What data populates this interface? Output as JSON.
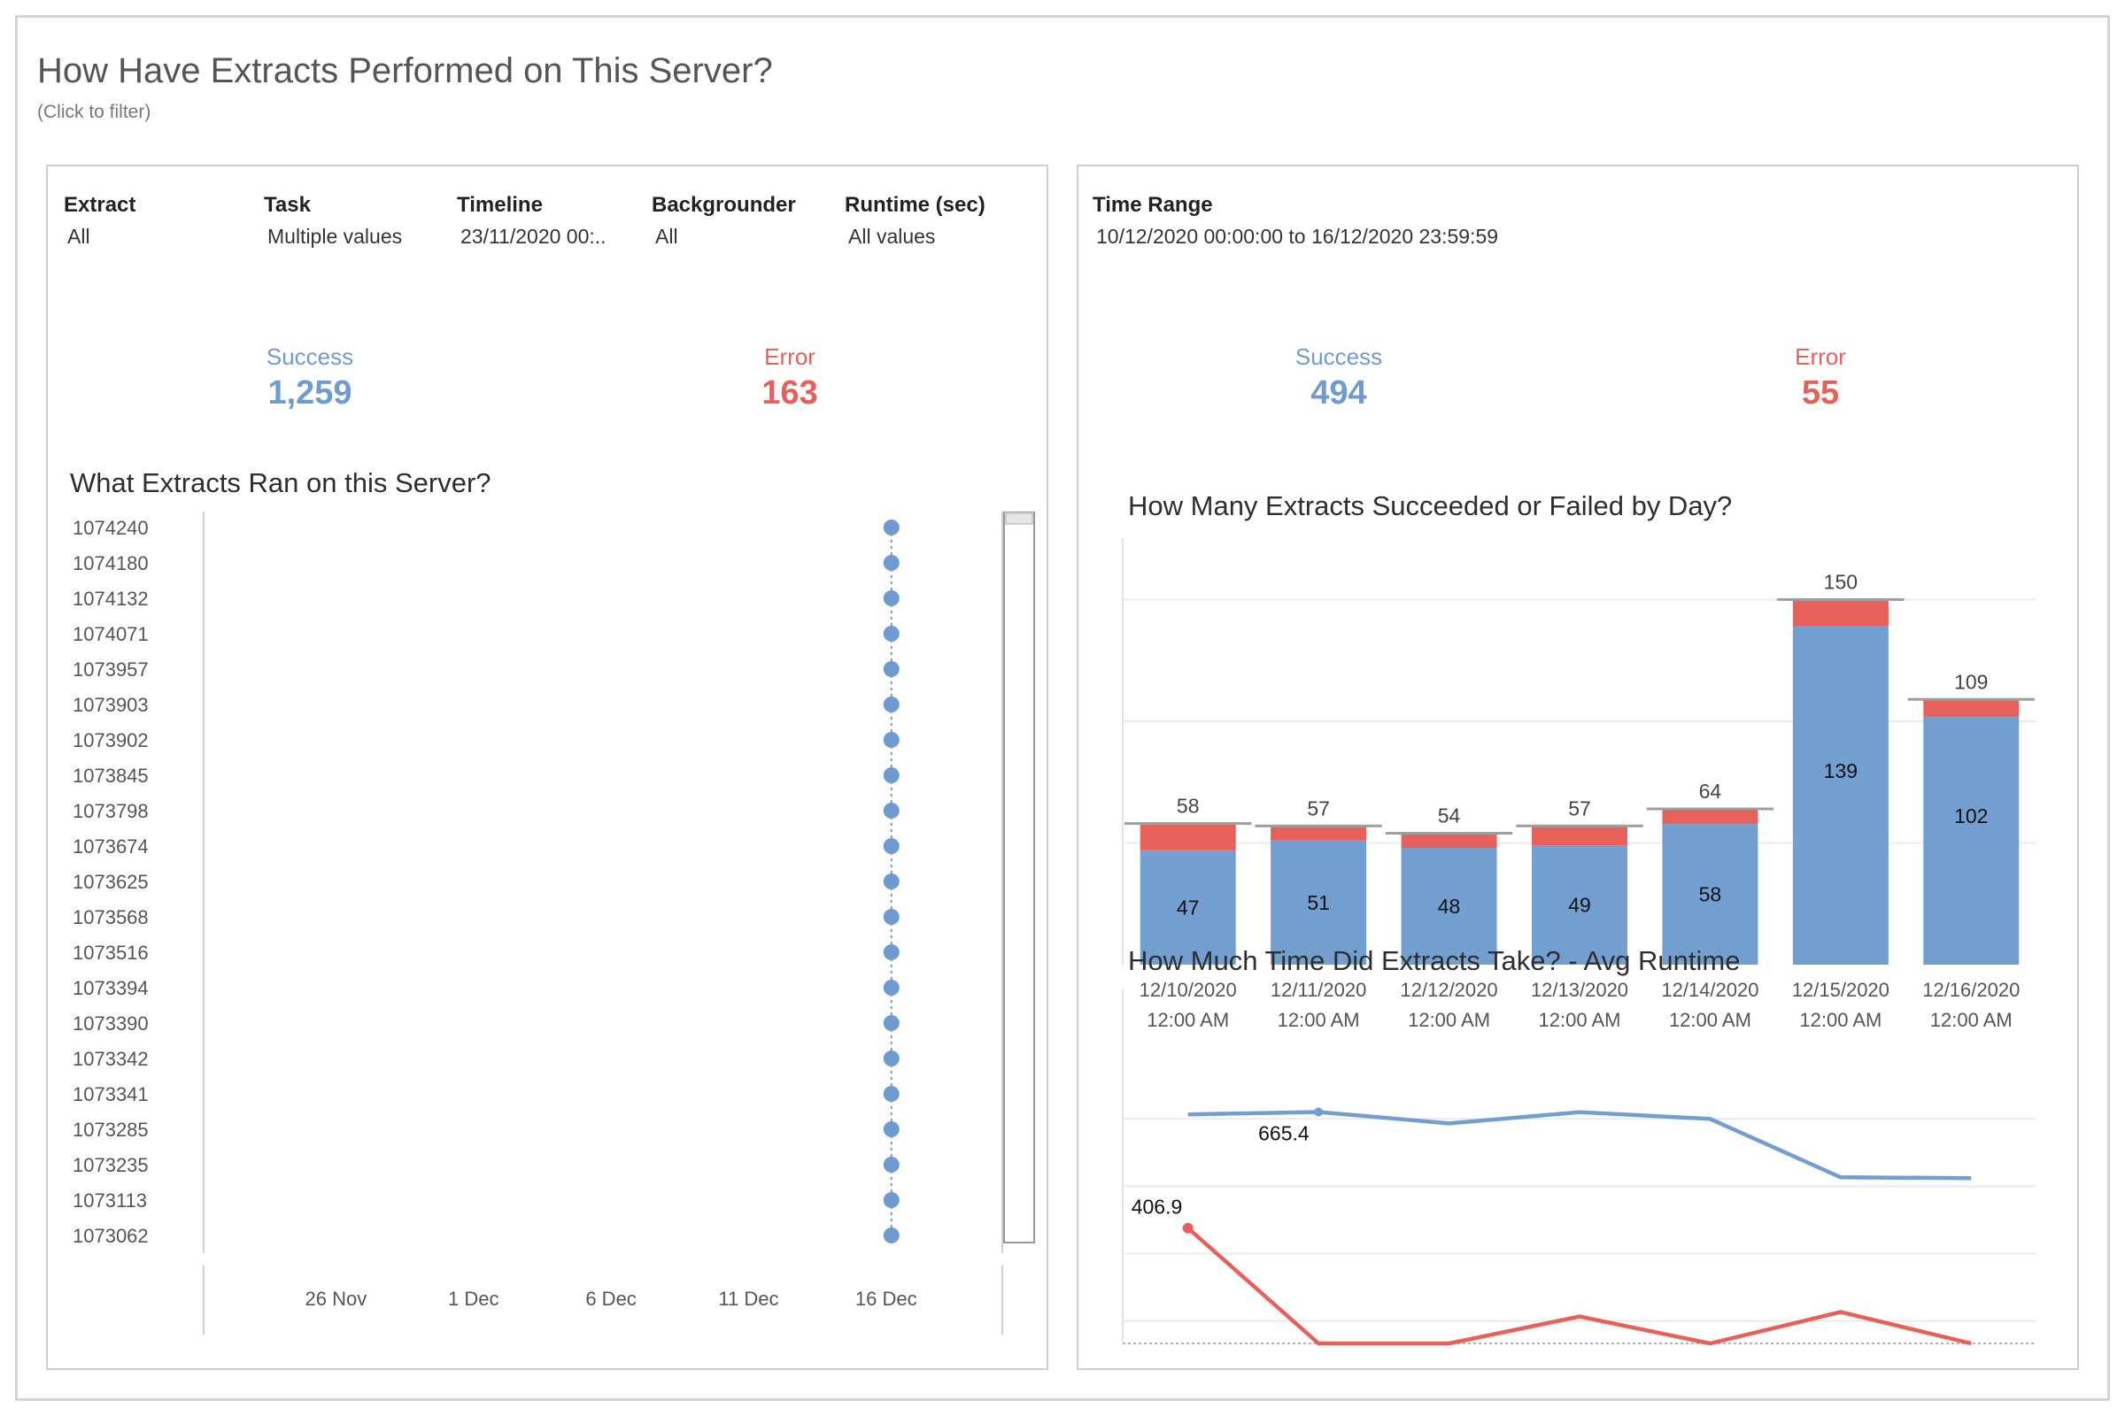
{
  "header": {
    "title": "How Have Extracts Performed on This Server?",
    "subtitle": "(Click to filter)"
  },
  "left_panel": {
    "filters": [
      {
        "label": "Extract",
        "value": "All"
      },
      {
        "label": "Task",
        "value": "Multiple values"
      },
      {
        "label": "Timeline",
        "value": "23/11/2020 00:.."
      },
      {
        "label": "Backgrounder",
        "value": "All"
      },
      {
        "label": "Runtime (sec)",
        "value": "All values"
      }
    ],
    "kpis": {
      "success_label": "Success",
      "success_value": "1,259",
      "error_label": "Error",
      "error_value": "163"
    },
    "chart_title": "What Extracts Ran on this Server?"
  },
  "right_panel": {
    "filters": [
      {
        "label": "Time Range",
        "value": "10/12/2020 00:00:00 to 16/12/2020 23:59:59"
      }
    ],
    "kpis": {
      "success_label": "Success",
      "success_value": "494",
      "error_label": "Error",
      "error_value": "55"
    },
    "bar_title": "How Many Extracts Succeeded or Failed by Day?",
    "line_title": "How Much Time Did Extracts Take? - Avg Runtime"
  },
  "colors": {
    "success": "#6f9bd1",
    "error": "#e8605a",
    "bar_success": "#729fcf",
    "axis": "#cccccc"
  },
  "chart_data": [
    {
      "type": "scatter",
      "title": "What Extracts Ran on this Server?",
      "y_categories": [
        "1074240",
        "1074180",
        "1074132",
        "1074071",
        "1073957",
        "1073903",
        "1073902",
        "1073845",
        "1073798",
        "1073674",
        "1073625",
        "1073568",
        "1073516",
        "1073394",
        "1073390",
        "1073342",
        "1073341",
        "1073285",
        "1073235",
        "1073113",
        "1073062"
      ],
      "x_ticks": [
        "26 Nov",
        "1 Dec",
        "6 Dec",
        "11 Dec",
        "16 Dec"
      ],
      "x_range": [
        "21 Nov",
        "19 Dec"
      ],
      "points_x": [
        "16 Dec",
        "16 Dec",
        "16 Dec",
        "16 Dec",
        "16 Dec",
        "16 Dec",
        "16 Dec",
        "16 Dec",
        "16 Dec",
        "16 Dec",
        "16 Dec",
        "16 Dec",
        "16 Dec",
        "16 Dec",
        "16 Dec",
        "16 Dec",
        "16 Dec",
        "16 Dec",
        "16 Dec",
        "16 Dec",
        "16 Dec"
      ],
      "grid": false
    },
    {
      "type": "bar",
      "title": "How Many Extracts Succeeded or Failed by Day?",
      "stacked": true,
      "categories": [
        "12/10/2020|12:00 AM",
        "12/11/2020|12:00 AM",
        "12/12/2020|12:00 AM",
        "12/13/2020|12:00 AM",
        "12/14/2020|12:00 AM",
        "12/15/2020|12:00 AM",
        "12/16/2020|12:00 AM"
      ],
      "series": [
        {
          "values": [
            47,
            51,
            48,
            49,
            58,
            139,
            102
          ]
        },
        {
          "values": [
            11,
            6,
            6,
            8,
            6,
            11,
            7
          ]
        }
      ],
      "totals": [
        58,
        57,
        54,
        57,
        64,
        150,
        109
      ],
      "ylim": [
        0,
        160
      ],
      "grid": true
    },
    {
      "type": "line",
      "title": "How Much Time Did Extracts Take? - Avg Runtime",
      "categories": [
        "12/10/2020|12:00 AM",
        "12/11/2020|12:00 AM",
        "12/12/2020|12:00 AM",
        "12/13/2020|12:00 AM",
        "12/14/2020|12:00 AM",
        "12/15/2020|12:00 AM",
        "12/16/2020|12:00 AM"
      ],
      "series": [
        {
          "values": [
            660,
            665.4,
            640,
            665,
            650,
            520,
            518
          ]
        },
        {
          "values": [
            406.9,
            150,
            150,
            210,
            150,
            220,
            150
          ]
        }
      ],
      "labels": [
        "665.4",
        "406.9"
      ],
      "ylim": [
        150,
        690
      ],
      "grid": true
    }
  ]
}
